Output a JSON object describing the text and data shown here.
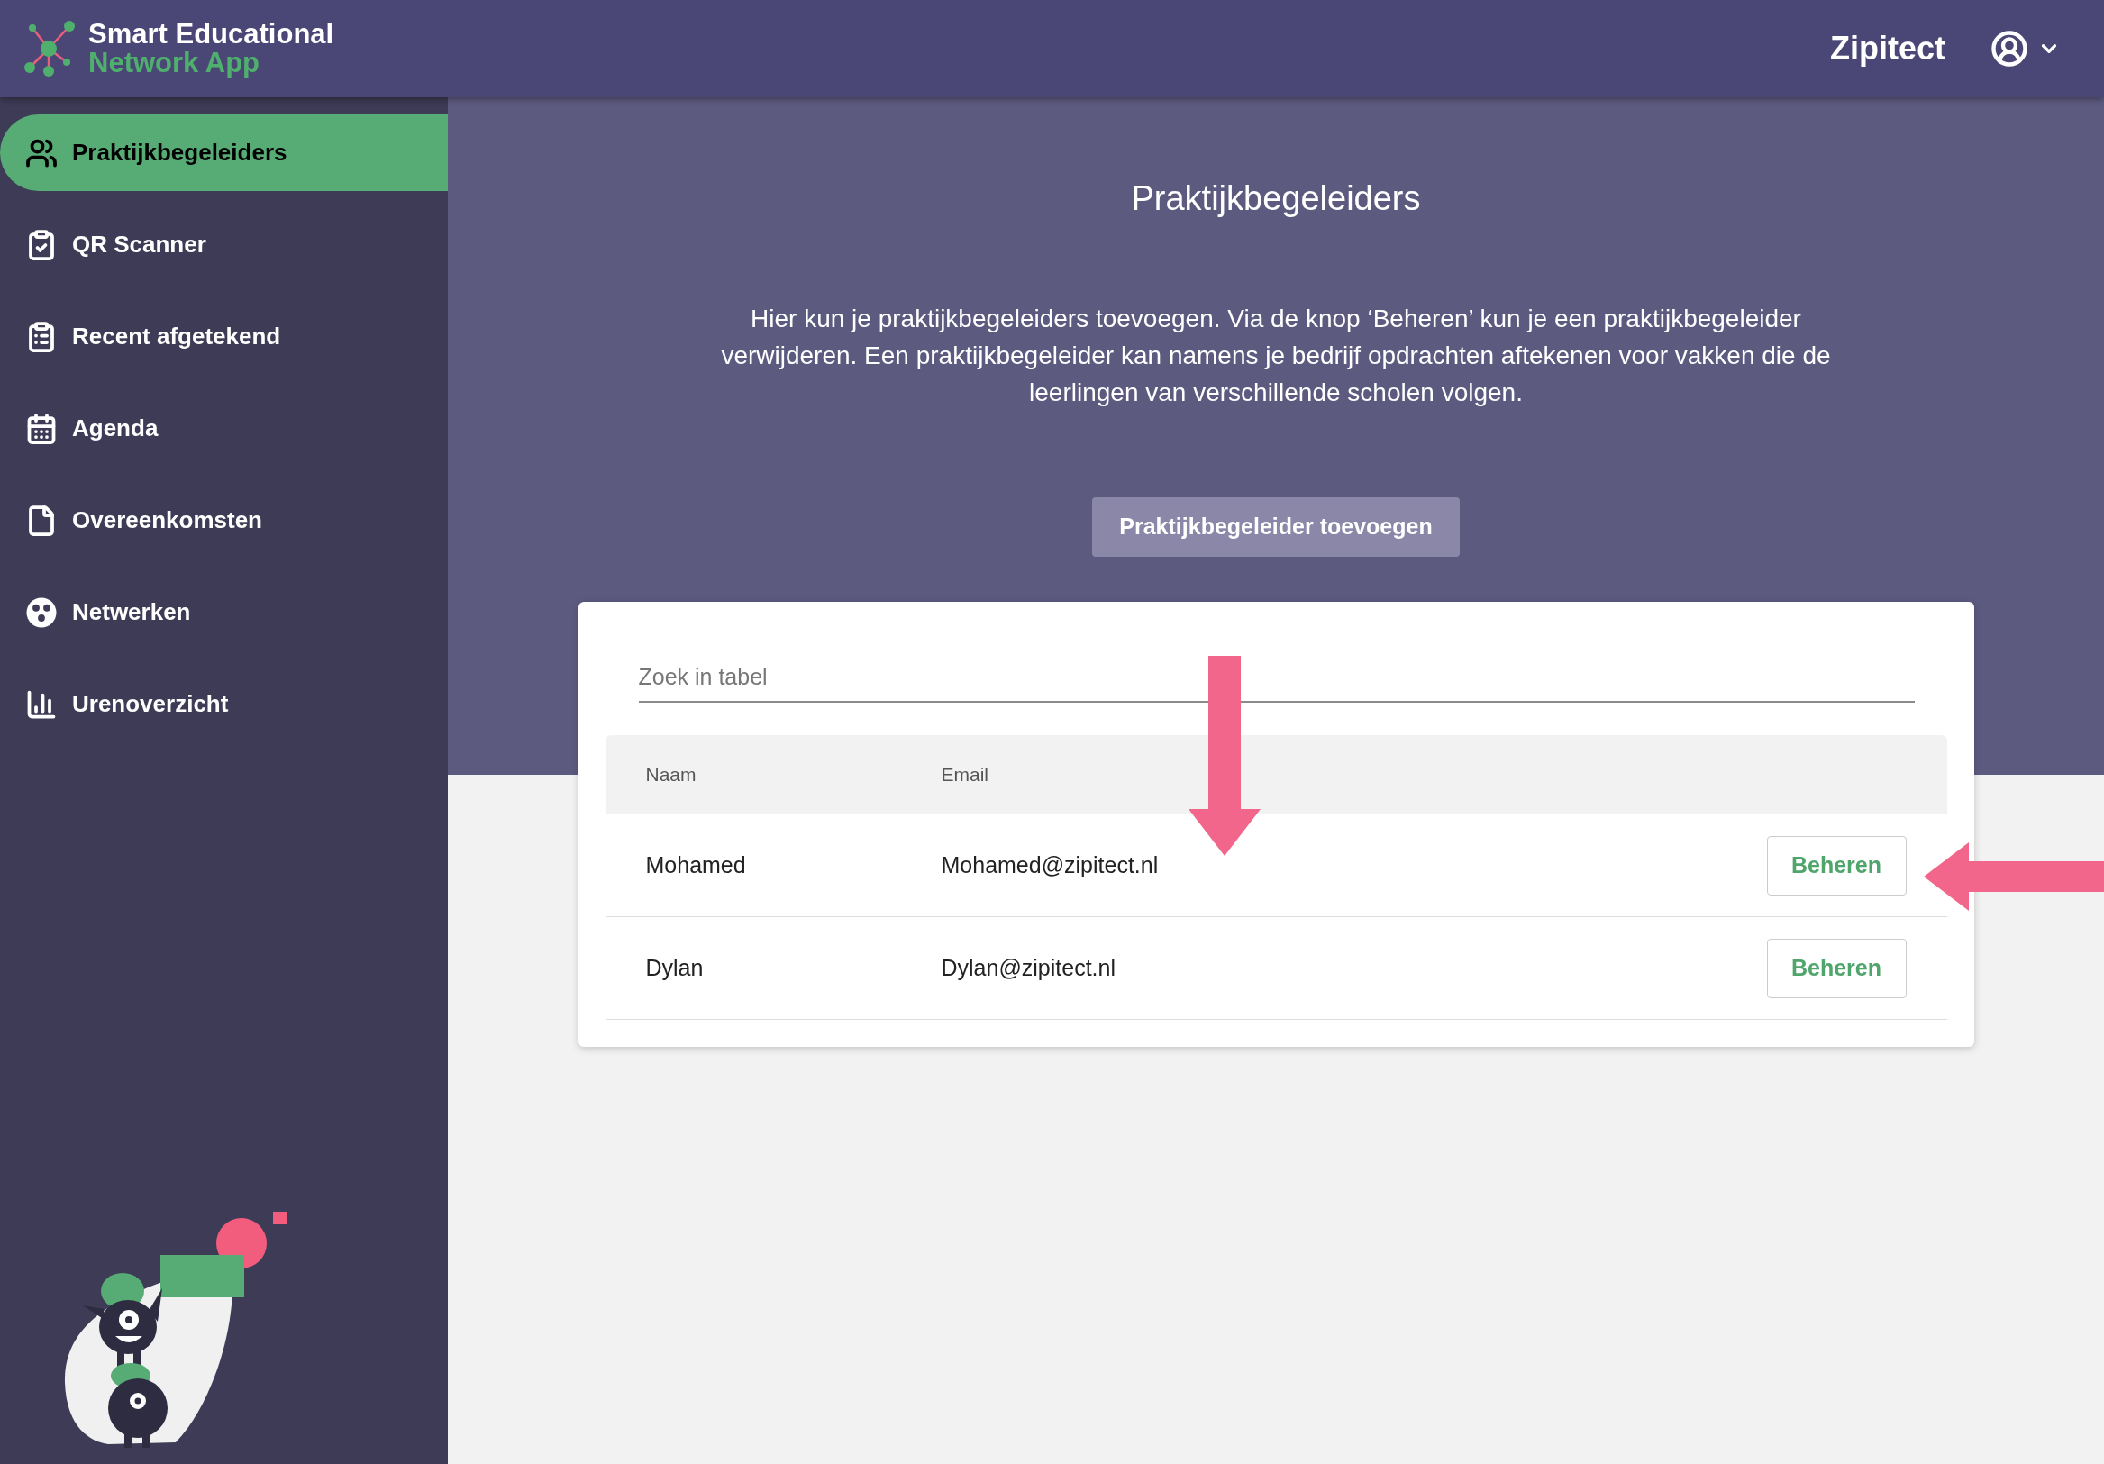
{
  "header": {
    "logo_line1": "Smart Educational",
    "logo_line2": "Network App",
    "company": "Zipitect"
  },
  "sidebar": {
    "items": [
      {
        "label": "Praktijkbegeleiders",
        "selected": true
      },
      {
        "label": "QR Scanner",
        "selected": false
      },
      {
        "label": "Recent afgetekend",
        "selected": false
      },
      {
        "label": "Agenda",
        "selected": false
      },
      {
        "label": "Overeenkomsten",
        "selected": false
      },
      {
        "label": "Netwerken",
        "selected": false
      },
      {
        "label": "Urenoverzicht",
        "selected": false
      }
    ]
  },
  "page": {
    "title": "Praktijkbegeleiders",
    "description": "Hier kun je praktijkbegeleiders toevoegen. Via de knop ‘Beheren’ kun je een praktijkbegeleider verwijderen. Een praktijkbegeleider kan namens je bedrijf opdrachten aftekenen voor vakken die de leerlingen van verschillende scholen volgen.",
    "add_button": "Praktijkbegeleider toevoegen",
    "search": {
      "placeholder": "Zoek in tabel"
    },
    "table": {
      "columns": [
        "Naam",
        "Email"
      ],
      "rows": [
        {
          "name": "Mohamed",
          "email": "Mohamed@zipitect.nl",
          "action": "Beheren"
        },
        {
          "name": "Dylan",
          "email": "Dylan@zipitect.nl",
          "action": "Beheren"
        }
      ]
    }
  },
  "annotations": [
    {
      "kind": "down"
    },
    {
      "kind": "left"
    }
  ]
}
